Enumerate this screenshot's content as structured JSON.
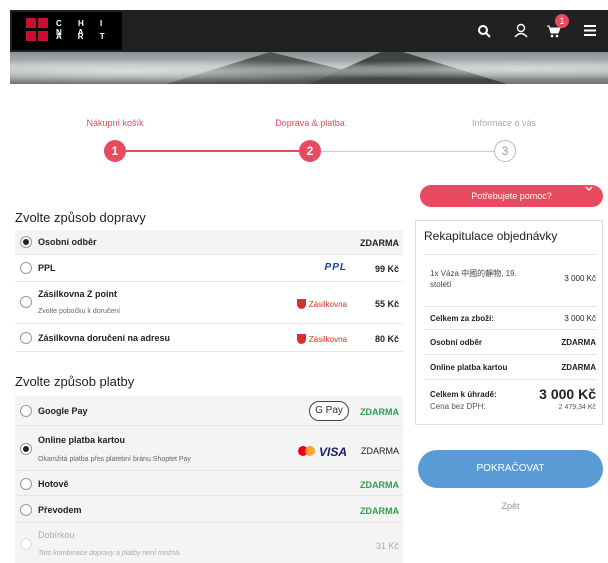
{
  "header": {
    "logo_line1": "C H I N A",
    "logo_line2": "A R T",
    "cart_count": "1"
  },
  "steps": [
    {
      "label": "Nákupní košík",
      "number": "1"
    },
    {
      "label": "Doprava & platba",
      "number": "2"
    },
    {
      "label": "Informace o vás",
      "number": "3"
    }
  ],
  "shipping": {
    "title": "Zvolte způsob dopravy",
    "options": [
      {
        "name": "Osobní odběr",
        "sub": "",
        "brand": "",
        "price": "ZDARMA",
        "selected": true
      },
      {
        "name": "PPL",
        "sub": "",
        "brand": "PPL",
        "price": "99 Kč",
        "selected": false
      },
      {
        "name": "Zásilkovna Z point",
        "sub": "Zvolte pobočku k doručení",
        "brand": "Zásilkovna",
        "price": "55 Kč",
        "selected": false
      },
      {
        "name": "Zásilkovna doručení na adresu",
        "sub": "",
        "brand": "Zásilkovna",
        "price": "80 Kč",
        "selected": false
      }
    ]
  },
  "payment": {
    "title": "Zvolte způsob platby",
    "options": [
      {
        "name": "Google Pay",
        "sub": "",
        "brand": "G Pay",
        "price": "ZDARMA",
        "selected": false
      },
      {
        "name": "Online platba kartou",
        "sub": "Okamžitá platba přes platební bránu Shoptet Pay",
        "brand": "VISA",
        "price": "ZDARMA",
        "selected": true
      },
      {
        "name": "Hotově",
        "sub": "",
        "brand": "",
        "price": "ZDARMA",
        "selected": false
      },
      {
        "name": "Převodem",
        "sub": "",
        "brand": "",
        "price": "ZDARMA",
        "selected": false
      },
      {
        "name": "Dobírkou",
        "sub": "Tato kombinace dopravy a platby není možná.",
        "brand": "",
        "price": "31 Kč",
        "selected": false
      }
    ]
  },
  "help": {
    "label": "Potřebujete pomoc?"
  },
  "summary": {
    "title": "Rekapitulace objednávky",
    "item_line1": "1x Váza 中國的靜物, 19.",
    "item_line2": "století",
    "item_price": "3 000 Kč",
    "goods_label": "Celkem za zboží:",
    "goods_value": "3 000 Kč",
    "shipping_label": "Osobní odběr",
    "shipping_value": "ZDARMA",
    "payment_label": "Online platba kartou",
    "payment_value": "ZDARMA",
    "total_label": "Celkem k úhradě:",
    "total_value": "3 000 Kč",
    "novat_label": "Cena bez DPH:",
    "novat_value": "2 479,34 Kč"
  },
  "actions": {
    "continue": "POKRAČOVAT",
    "back": "Zpět"
  },
  "colors": {
    "accent": "#e84a5f",
    "button": "#5b9bd5",
    "free": "#2aa24b"
  }
}
